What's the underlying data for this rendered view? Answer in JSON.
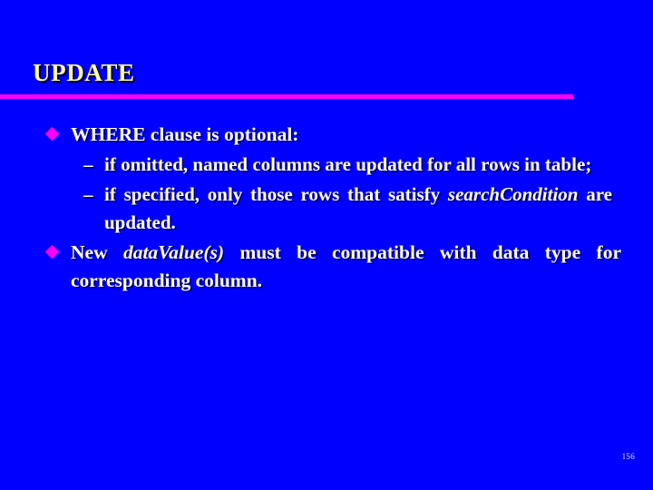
{
  "slide": {
    "title": "UPDATE",
    "background_color": "#0000FF",
    "title_color": "#FFFF99",
    "rule_color": "#FF00FF",
    "body_text_color": "#FFFFFF",
    "bullet_color": "#FF00FF",
    "page_number": "156"
  },
  "bullets": [
    {
      "level": 1,
      "marker": "diamond-bullet",
      "text": "WHERE clause is optional:"
    },
    {
      "level": 2,
      "marker": "en-dash",
      "dash": "–",
      "text": "if omitted, named columns are updated for all rows in table;"
    },
    {
      "level": 2,
      "marker": "en-dash",
      "dash": "–",
      "text_before": "if specified, only those rows that satisfy ",
      "emphasis": "searchCondition",
      "text_after": " are updated."
    },
    {
      "level": 1,
      "marker": "diamond-bullet",
      "text_before": "New ",
      "emphasis": "dataValue(s)",
      "text_after": " must be compatible with data type for corresponding column."
    }
  ]
}
